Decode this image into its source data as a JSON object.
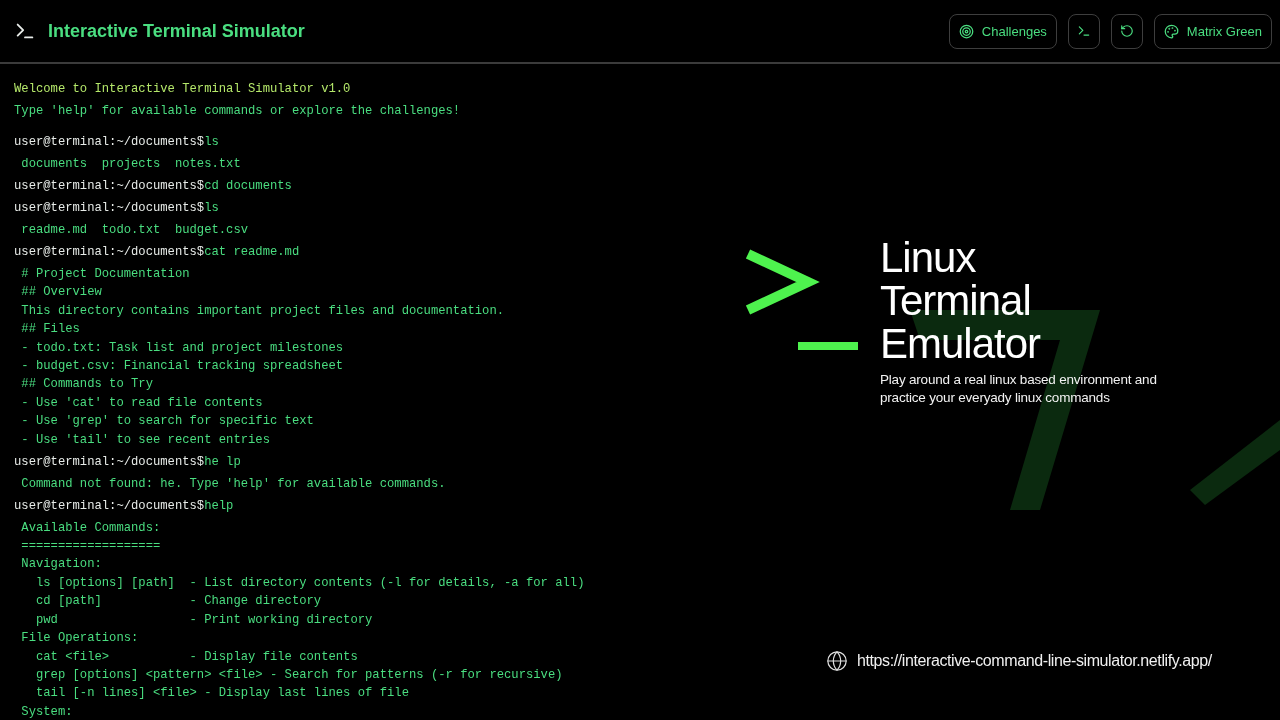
{
  "header": {
    "title": "Interactive Terminal Simulator",
    "buttons": [
      {
        "kind": "challenges",
        "label": "Challenges"
      },
      {
        "kind": "terminal"
      },
      {
        "kind": "reset"
      },
      {
        "kind": "theme",
        "label": "Matrix Green"
      }
    ]
  },
  "terminal": {
    "banner": [
      "Welcome to Interactive Terminal Simulator v1.0",
      "Type 'help' for available commands or explore the challenges!"
    ],
    "entries": [
      {
        "kind": "prompt",
        "prompt": "user@terminal:~/documents$",
        "command": "ls"
      },
      {
        "kind": "output",
        "lines": [
          " documents  projects  notes.txt"
        ]
      },
      {
        "kind": "prompt",
        "prompt": "user@terminal:~/documents$",
        "command": "cd documents"
      },
      {
        "kind": "prompt",
        "prompt": "user@terminal:~/documents$",
        "command": "ls"
      },
      {
        "kind": "output",
        "lines": [
          " readme.md  todo.txt  budget.csv"
        ]
      },
      {
        "kind": "prompt",
        "prompt": "user@terminal:~/documents$",
        "command": "cat readme.md"
      },
      {
        "kind": "output",
        "lines": [
          " # Project Documentation",
          " ## Overview",
          " This directory contains important project files and documentation.",
          " ## Files",
          " - todo.txt: Task list and project milestones",
          " - budget.csv: Financial tracking spreadsheet",
          " ## Commands to Try",
          " - Use 'cat' to read file contents",
          " - Use 'grep' to search for specific text",
          " - Use 'tail' to see recent entries"
        ]
      },
      {
        "kind": "prompt",
        "prompt": "user@terminal:~/documents$",
        "command": "he lp"
      },
      {
        "kind": "output",
        "lines": [
          " Command not found: he. Type 'help' for available commands."
        ]
      },
      {
        "kind": "prompt",
        "prompt": "user@terminal:~/documents$",
        "command": "help"
      },
      {
        "kind": "output",
        "lines": [
          " Available Commands:",
          " ===================",
          " Navigation:",
          "   ls [options] [path]  - List directory contents (-l for details, -a for all)",
          "   cd [path]            - Change directory",
          "   pwd                  - Print working directory",
          " File Operations:",
          "   cat <file>           - Display file contents",
          "   grep [options] <pattern> <file> - Search for patterns (-r for recursive)",
          "   tail [-n lines] <file> - Display last lines of file",
          " System:"
        ]
      }
    ]
  },
  "promo": {
    "title": "Linux Terminal Emulator",
    "subtitle": "Play around a real linux based environment and practice your everyady linux commands",
    "url": "https://interactive-command-line-simulator.netlify.app/"
  }
}
